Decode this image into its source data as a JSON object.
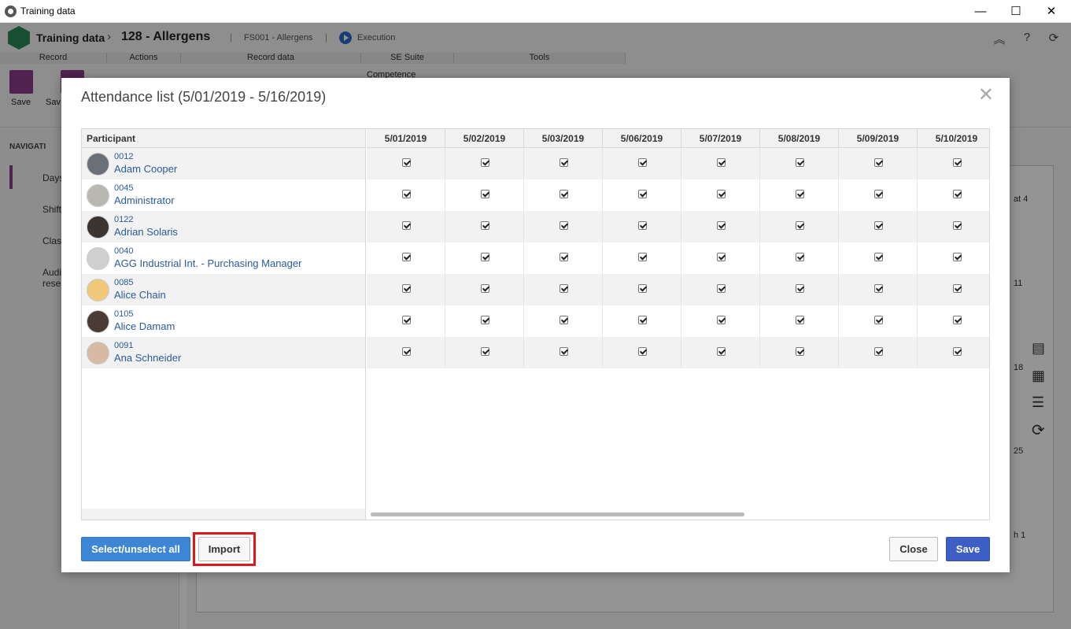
{
  "window": {
    "title": "Training data",
    "minimize": "—",
    "maximize": "☐",
    "close": "✕"
  },
  "header": {
    "app": "Training data",
    "record": "128 - Allergens",
    "sep": "|",
    "code": "FS001 - Allergens",
    "status": "Execution"
  },
  "ribbon": {
    "groups": [
      "Record",
      "Actions",
      "Record data",
      "SE Suite",
      "Tools"
    ],
    "save": "Save",
    "save2": "Sav",
    "competence": "Competence"
  },
  "nav": {
    "heading": "NAVIGATI",
    "items": [
      "Days",
      "Shift",
      "Clas",
      "Audi rese"
    ]
  },
  "calendar": {
    "days": [
      "at 4",
      "11",
      "18",
      "25",
      "h 1"
    ]
  },
  "dialog": {
    "title": "Attendance list (5/01/2019 - 5/16/2019)",
    "close_icon": "✕",
    "participant_header": "Participant",
    "dates": [
      "5/01/2019",
      "5/02/2019",
      "5/03/2019",
      "5/06/2019",
      "5/07/2019",
      "5/08/2019",
      "5/09/2019",
      "5/10/2019"
    ],
    "participants": [
      {
        "code": "0012",
        "name": "Adam Cooper",
        "avatar": "photo-man-suit",
        "checked": [
          true,
          true,
          true,
          true,
          true,
          true,
          true,
          true
        ]
      },
      {
        "code": "0045",
        "name": "Administrator",
        "avatar": "photo-admin",
        "checked": [
          true,
          true,
          true,
          true,
          true,
          true,
          true,
          true
        ]
      },
      {
        "code": "0122",
        "name": "Adrian Solaris",
        "avatar": "photo-man-dark",
        "checked": [
          true,
          true,
          true,
          true,
          true,
          true,
          true,
          true
        ]
      },
      {
        "code": "0040",
        "name": "AGG Industrial Int. - Purchasing Manager",
        "avatar": "placeholder-person",
        "checked": [
          true,
          true,
          true,
          true,
          true,
          true,
          true,
          true
        ]
      },
      {
        "code": "0085",
        "name": "Alice Chain",
        "avatar": "cartoon-woman",
        "checked": [
          true,
          true,
          true,
          true,
          true,
          true,
          true,
          true
        ]
      },
      {
        "code": "0105",
        "name": "Alice Damam",
        "avatar": "photo-woman-dark",
        "checked": [
          true,
          true,
          true,
          true,
          true,
          true,
          true,
          true
        ]
      },
      {
        "code": "0091",
        "name": "Ana Schneider",
        "avatar": "photo-woman-light",
        "checked": [
          true,
          true,
          true,
          true,
          true,
          true,
          true,
          true
        ]
      }
    ],
    "buttons": {
      "select_all": "Select/unselect all",
      "import": "Import",
      "close": "Close",
      "save": "Save"
    }
  },
  "colors": {
    "primary": "#3d86d6",
    "save": "#3d5ec4",
    "highlight": "#e0161b",
    "link": "#2a5a9e"
  }
}
